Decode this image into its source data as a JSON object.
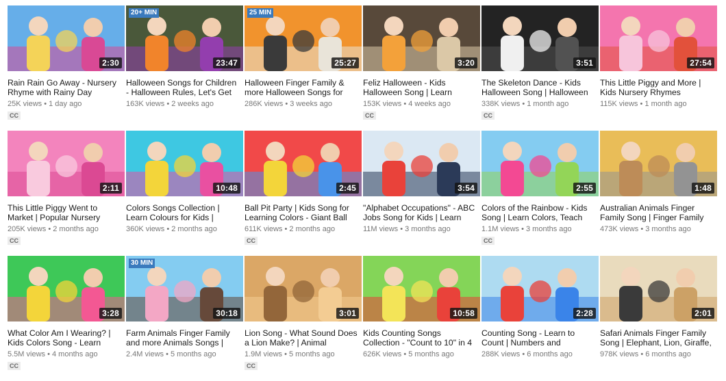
{
  "videos": [
    {
      "title": "Rain Rain Go Away - Nursery Rhyme with Rainy Day",
      "views": "25K views",
      "age": "1 day ago",
      "duration": "2:30",
      "cc": "CC",
      "badge": "",
      "colors": [
        "#5aa8e8",
        "#f4d04a",
        "#d63a8c"
      ]
    },
    {
      "title": "Halloween Songs for Children - Halloween Rules, Let's Get",
      "views": "163K views",
      "age": "2 weeks ago",
      "duration": "23:47",
      "cc": "",
      "badge": "20+ MIN",
      "colors": [
        "#3b4a2a",
        "#f07a1a",
        "#8a2ea8"
      ]
    },
    {
      "title": "Halloween Finger Family & more Halloween Songs for",
      "views": "286K views",
      "age": "3 weeks ago",
      "duration": "25:27",
      "cc": "",
      "badge": "25 MIN",
      "colors": [
        "#f08a1c",
        "#2a2a2a",
        "#e8e2d6"
      ]
    },
    {
      "title": "Feliz Halloween - Kids Halloween Song | Learn",
      "views": "153K views",
      "age": "4 weeks ago",
      "duration": "3:20",
      "cc": "CC",
      "badge": "",
      "colors": [
        "#4a3a2a",
        "#f29a2a",
        "#d8c4a0"
      ]
    },
    {
      "title": "The Skeleton Dance - Kids Halloween Song | Halloween",
      "views": "338K views",
      "age": "1 month ago",
      "duration": "3:51",
      "cc": "CC",
      "badge": "",
      "colors": [
        "#111111",
        "#efefef",
        "#444444"
      ]
    },
    {
      "title": "This Little Piggy and More | Kids Nursery Rhymes",
      "views": "115K views",
      "age": "1 month ago",
      "duration": "27:54",
      "cc": "",
      "badge": "",
      "colors": [
        "#f46aa8",
        "#f7c0d8",
        "#e0432b"
      ]
    },
    {
      "title": "This Little Piggy Went to Market | Popular Nursery",
      "views": "205K views",
      "age": "2 months ago",
      "duration": "2:11",
      "cc": "CC",
      "badge": "",
      "colors": [
        "#f27ab8",
        "#f9c6dc",
        "#d83a8a"
      ]
    },
    {
      "title": "Colors Songs Collection | Learn Colours for Kids |",
      "views": "360K views",
      "age": "2 months ago",
      "duration": "10:48",
      "cc": "",
      "badge": "",
      "colors": [
        "#2ec4e0",
        "#f2d22a",
        "#e8429a"
      ]
    },
    {
      "title": "Ball Pit Party | Kids Song for Learning Colors - Giant Ball",
      "views": "611K views",
      "age": "2 months ago",
      "duration": "2:45",
      "cc": "CC",
      "badge": "",
      "colors": [
        "#f03a3a",
        "#f2d22a",
        "#3a8ae8"
      ]
    },
    {
      "title": "\"Alphabet Occupations\" - ABC Jobs Song for Kids | Learn",
      "views": "11M views",
      "age": "3 months ago",
      "duration": "3:54",
      "cc": "",
      "badge": "",
      "colors": [
        "#d8e6f2",
        "#e8322a",
        "#1a2a4a"
      ]
    },
    {
      "title": "Colors of the Rainbow - Kids Song | Learn Colors, Teach",
      "views": "1.1M views",
      "age": "3 months ago",
      "duration": "2:55",
      "cc": "CC",
      "badge": "",
      "colors": [
        "#7ac8f0",
        "#f23a8a",
        "#8ad24a"
      ]
    },
    {
      "title": "Australian Animals Finger Family Song | Finger Family",
      "views": "473K views",
      "age": "3 months ago",
      "duration": "1:48",
      "cc": "",
      "badge": "",
      "colors": [
        "#e8b84a",
        "#b8834a",
        "#8a8a8a"
      ]
    },
    {
      "title": "What Color Am I Wearing? | Kids Colors Song - Learn",
      "views": "5.5M views",
      "age": "4 months ago",
      "duration": "3:28",
      "cc": "CC",
      "badge": "",
      "colors": [
        "#2ec44a",
        "#f2d22a",
        "#f24a8a"
      ]
    },
    {
      "title": "Farm Animals Finger Family and more Animals Songs |",
      "views": "2.4M views",
      "age": "5 months ago",
      "duration": "30:18",
      "cc": "",
      "badge": "30 MIN",
      "colors": [
        "#7ac8f0",
        "#f2a0c0",
        "#5a3a2a"
      ]
    },
    {
      "title": "Lion Song - What Sound Does a Lion Make? | Animal",
      "views": "1.9M views",
      "age": "5 months ago",
      "duration": "3:01",
      "cc": "CC",
      "badge": "",
      "colors": [
        "#d8a05a",
        "#8a5a2a",
        "#f2c88a"
      ]
    },
    {
      "title": "Kids Counting Songs Collection - \"Count to 10\" in 4",
      "views": "626K views",
      "age": "5 months ago",
      "duration": "10:58",
      "cc": "",
      "badge": "",
      "colors": [
        "#7ad24a",
        "#f2e24a",
        "#e8322a"
      ]
    },
    {
      "title": "Counting Song - Learn to Count | Numbers and",
      "views": "288K views",
      "age": "6 months ago",
      "duration": "2:28",
      "cc": "",
      "badge": "",
      "colors": [
        "#a8d8f0",
        "#e8322a",
        "#2a7ae8"
      ]
    },
    {
      "title": "Safari Animals Finger Family Song | Elephant, Lion, Giraffe,",
      "views": "978K views",
      "age": "6 months ago",
      "duration": "2:01",
      "cc": "",
      "badge": "",
      "colors": [
        "#e8d8b8",
        "#2a2a2a",
        "#c89a5a"
      ]
    }
  ]
}
